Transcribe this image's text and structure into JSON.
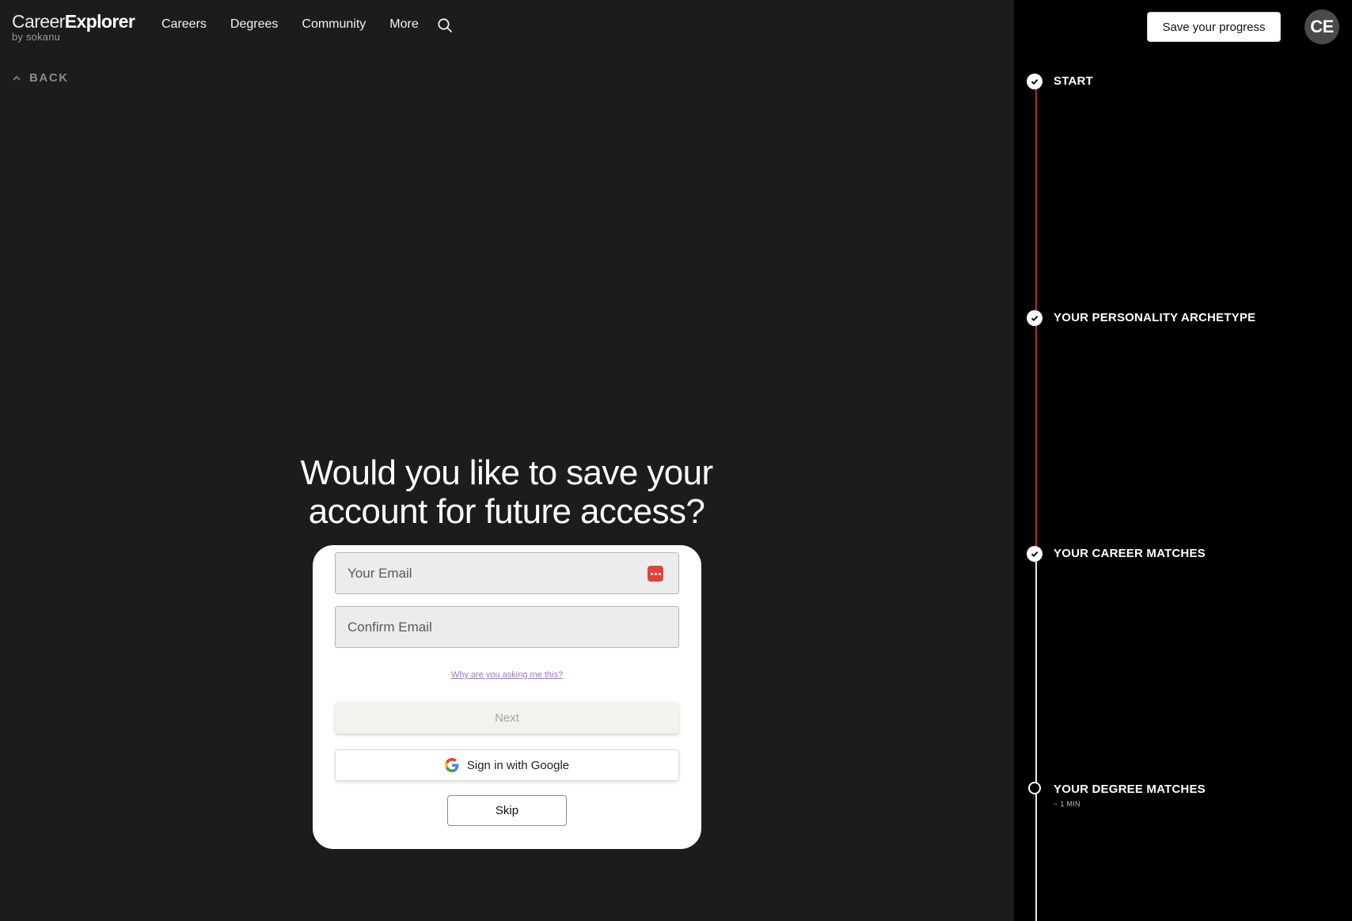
{
  "header": {
    "logo_part1": "Career",
    "logo_part2": "Explorer",
    "logo_sub": "by sokanu",
    "nav": [
      "Careers",
      "Degrees",
      "Community",
      "More"
    ],
    "search_icon": "search-icon"
  },
  "back": {
    "label": "BACK",
    "icon": "chevron-up-icon"
  },
  "question": "Would you like to save your account for future access?",
  "form": {
    "email_placeholder": "Your Email",
    "confirm_placeholder": "Confirm Email",
    "why_link": "Why are you asking me this?",
    "next_label": "Next",
    "google_label": "Sign in with Google",
    "skip_label": "Skip"
  },
  "panel": {
    "save_label": "Save your progress",
    "avatar_initials": "CE",
    "steps": [
      {
        "label": "START",
        "status": "done"
      },
      {
        "label": "YOUR PERSONALITY ARCHETYPE",
        "status": "done"
      },
      {
        "label": "YOUR CAREER MATCHES",
        "status": "done"
      },
      {
        "label": "YOUR DEGREE MATCHES",
        "status": "pending",
        "sub": "~ 1 MIN"
      }
    ]
  },
  "colors": {
    "background": "#1c1c1c",
    "panel": "#000000",
    "progress_line": "#c8203a",
    "link": "#9a78c4"
  }
}
